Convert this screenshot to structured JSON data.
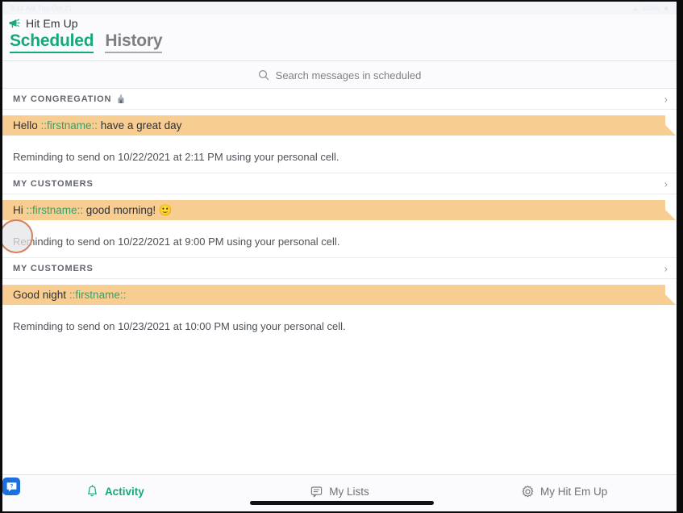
{
  "status_bar": {
    "left_text": "9:41 AM  Thu Oct 21",
    "right_text": "100%"
  },
  "header": {
    "brand_icon": "megaphone-icon",
    "brand_name": "Hit Em Up",
    "tabs": [
      {
        "label": "Scheduled",
        "active": true
      },
      {
        "label": "History",
        "active": false
      }
    ]
  },
  "search": {
    "icon": "search-icon",
    "placeholder": "Search messages in scheduled",
    "value": ""
  },
  "sections": [
    {
      "title": "MY CONGREGATION",
      "has_badge_icon": true,
      "badge_icon": "church-icon",
      "chevron": "›",
      "message_prefix": "Hello ",
      "message_token": "::firstname::",
      "message_suffix": " have a great day",
      "reminder": "Reminding to send on 10/22/2021 at 2:11 PM using your personal cell."
    },
    {
      "title": "MY CUSTOMERS",
      "has_badge_icon": false,
      "badge_icon": "",
      "chevron": "›",
      "message_prefix": "Hi ",
      "message_token": "::firstname::",
      "message_suffix": " good morning! 🙂",
      "reminder": "Reminding to send on 10/22/2021 at 9:00 PM using your personal cell."
    },
    {
      "title": "MY CUSTOMERS",
      "has_badge_icon": false,
      "badge_icon": "",
      "chevron": "›",
      "message_prefix": "Good night ",
      "message_token": "::firstname::",
      "message_suffix": "",
      "reminder": "Reminding to send on 10/23/2021 at 10:00 PM using your personal cell."
    }
  ],
  "tab_bar": {
    "items": [
      {
        "label": "Activity",
        "icon": "bell-icon",
        "active": true
      },
      {
        "label": "My Lists",
        "icon": "chat-icon",
        "active": false
      },
      {
        "label": "My Hit Em Up",
        "icon": "gear-icon",
        "active": false
      }
    ]
  },
  "help_button": {
    "label": "?",
    "icon": "help-bubble-icon"
  },
  "colors": {
    "accent_green": "#13a97b",
    "bubble_orange": "#f7cd92",
    "token_green": "#38a06a",
    "help_blue": "#1d6fe0",
    "cursor_ring": "#d0825a"
  }
}
